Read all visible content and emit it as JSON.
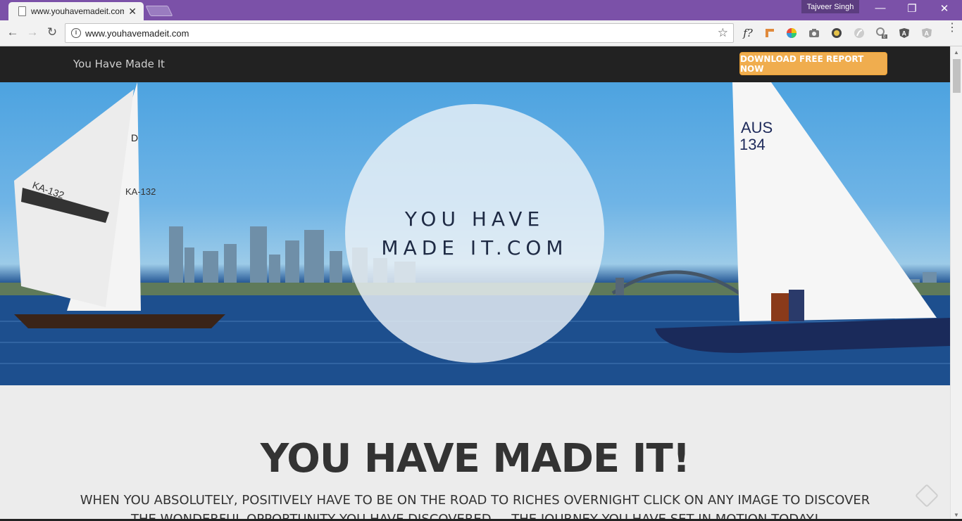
{
  "browser": {
    "tab_title": "www.youhavemadeit.com",
    "tab_close": "✕",
    "profile_name": "Tajveer Singh",
    "url": "www.youhavemadeit.com",
    "window_controls": {
      "minimize": "—",
      "restore": "❐",
      "close": "✕"
    },
    "nav": {
      "back": "←",
      "forward": "→",
      "reload": "↻"
    },
    "extensions": [
      "f?",
      "ruler-icon",
      "color-wheel-icon",
      "camera-icon",
      "lightbulb-icon",
      "feather-icon",
      "gear-icon",
      "angular-icon",
      "angular-grey-icon"
    ],
    "extension_labels": {
      "fonts": "f?"
    }
  },
  "site": {
    "brand": "You Have Made It",
    "cta_label": "DOWNLOAD FREE REPORT NOW",
    "hero_line1": "YOU HAVE",
    "hero_line2": "MADE IT.COM",
    "headline": "YOU HAVE MADE IT!",
    "subtext": "WHEN YOU ABSOLUTELY, POSITIVELY HAVE TO BE ON THE ROAD TO RICHES OVERNIGHT CLICK ON ANY IMAGE TO DISCOVER THE WONDERFUL OPPORTUNITY YOU HAVE DISCOVERED ... THE JOURNEY YOU HAVE SET IN MOTION TODAY!"
  }
}
